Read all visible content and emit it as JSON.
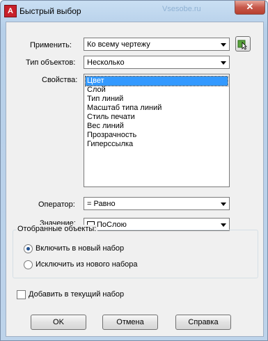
{
  "window": {
    "title": "Быстрый выбор",
    "watermark": "Vsesobe.ru",
    "close_glyph": "✕"
  },
  "apply": {
    "label": "Применить:",
    "value": "Ко всему чертежу"
  },
  "object_type": {
    "label": "Тип объектов:",
    "value": "Несколько"
  },
  "properties": {
    "label": "Свойства:",
    "items": [
      "Цвет",
      "Слой",
      "Тип линий",
      "Масштаб типа линий",
      "Стиль печати",
      "Вес линий",
      "Прозрачность",
      "Гиперссылка"
    ],
    "selected": "Цвет"
  },
  "operator": {
    "label": "Оператор:",
    "value": "= Равно"
  },
  "value": {
    "label": "Значение:",
    "value": "ПоСлою"
  },
  "selected_objects": {
    "title": "Отобранные объекты:",
    "include_label": "Включить в новый набор",
    "exclude_label": "Исключить из нового набора",
    "selected": "include"
  },
  "append": {
    "label": "Добавить в текущий набор",
    "checked": false
  },
  "buttons": {
    "ok": "OK",
    "cancel": "Отмена",
    "help": "Справка"
  },
  "icons": {
    "app": "autocad-icon",
    "pick": "select-objects-icon"
  }
}
